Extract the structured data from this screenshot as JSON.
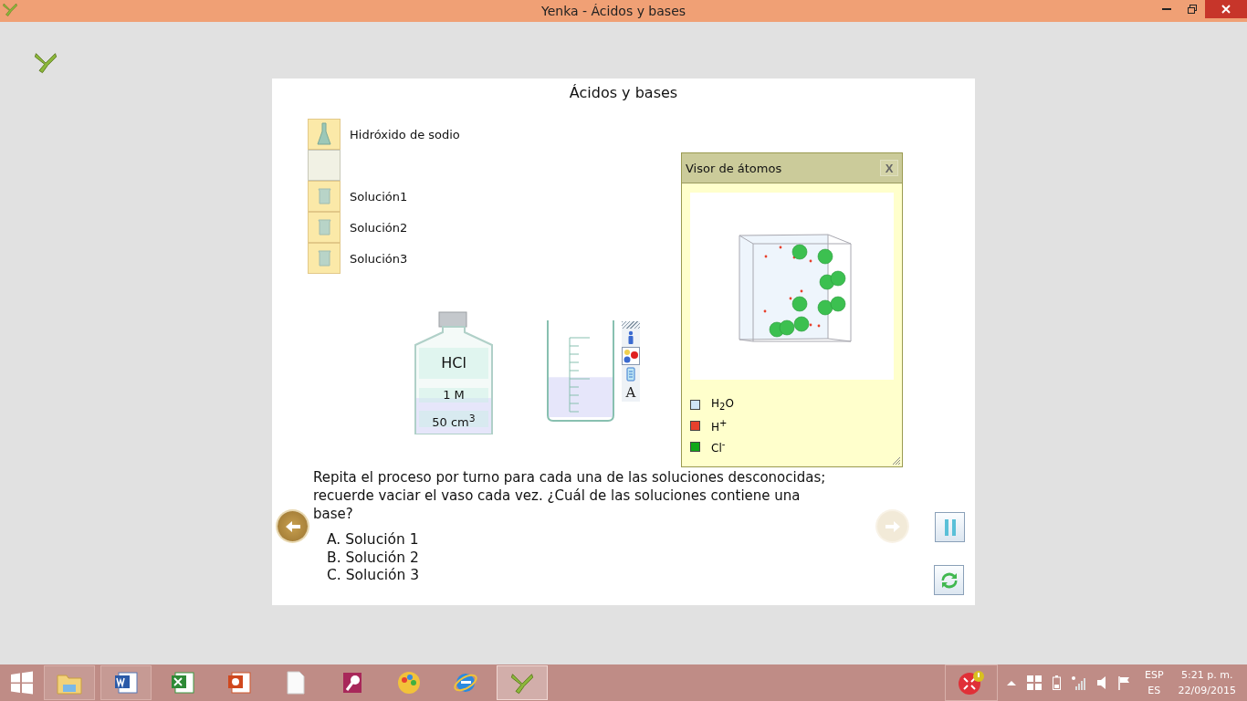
{
  "window": {
    "title": "Yenka - Ácidos y bases"
  },
  "page_title": "Ácidos y bases",
  "shelf": [
    {
      "kind": "flask",
      "label": "Hidróxido de sodio"
    },
    {
      "kind": "empty"
    },
    {
      "kind": "beaker",
      "label": "Solución1"
    },
    {
      "kind": "beaker",
      "label": "Solución2"
    },
    {
      "kind": "beaker",
      "label": "Solución3"
    }
  ],
  "bottle": {
    "name": "HCl",
    "concentration": "1 M",
    "volume": "50 cm$^{3}$",
    "level": 0.33
  },
  "beaker": {
    "level": 0.43
  },
  "beaker_tools": [
    {
      "kind": "info",
      "selected": false
    },
    {
      "kind": "atoms",
      "selected": true
    },
    {
      "kind": "cylinder",
      "selected": false
    },
    {
      "kind": "text",
      "label": "A",
      "selected": false
    }
  ],
  "atom_viewer": {
    "title": "Visor de átomos",
    "close": "X",
    "legend": [
      {
        "label": "H$_{2}$O",
        "color": "#cfe3f7"
      },
      {
        "label": "H$^{+}$",
        "color": "#e8402c"
      },
      {
        "label": "Cl$^{-}$",
        "color": "#10a818"
      }
    ]
  },
  "question": {
    "text": "Repita el proceso por turno para cada una de las soluciones desconocidas; recuerde vaciar el vaso cada vez. ¿Cuál de las soluciones contiene una base?",
    "options": [
      "A. Solución 1",
      "B. Solución 2",
      "C. Solución 3"
    ]
  },
  "navigation": {
    "back_disabled": false,
    "forward_disabled": true
  },
  "taskbar": {
    "apps": [
      {
        "kind": "explorer",
        "running": true,
        "selected": false
      },
      {
        "kind": "word",
        "running": true,
        "selected": false
      },
      {
        "kind": "excel",
        "running": false,
        "selected": false
      },
      {
        "kind": "powerpoint",
        "running": false,
        "selected": false
      },
      {
        "kind": "document",
        "running": false,
        "selected": false
      },
      {
        "kind": "access",
        "running": false,
        "selected": false
      },
      {
        "kind": "paint",
        "running": false,
        "selected": false
      },
      {
        "kind": "browser",
        "running": false,
        "selected": false
      },
      {
        "kind": "yenka",
        "running": true,
        "selected": true
      }
    ],
    "language": "ESP",
    "keyboard": "ES",
    "time": "5:21 p. m.",
    "date": "22/09/2015"
  }
}
